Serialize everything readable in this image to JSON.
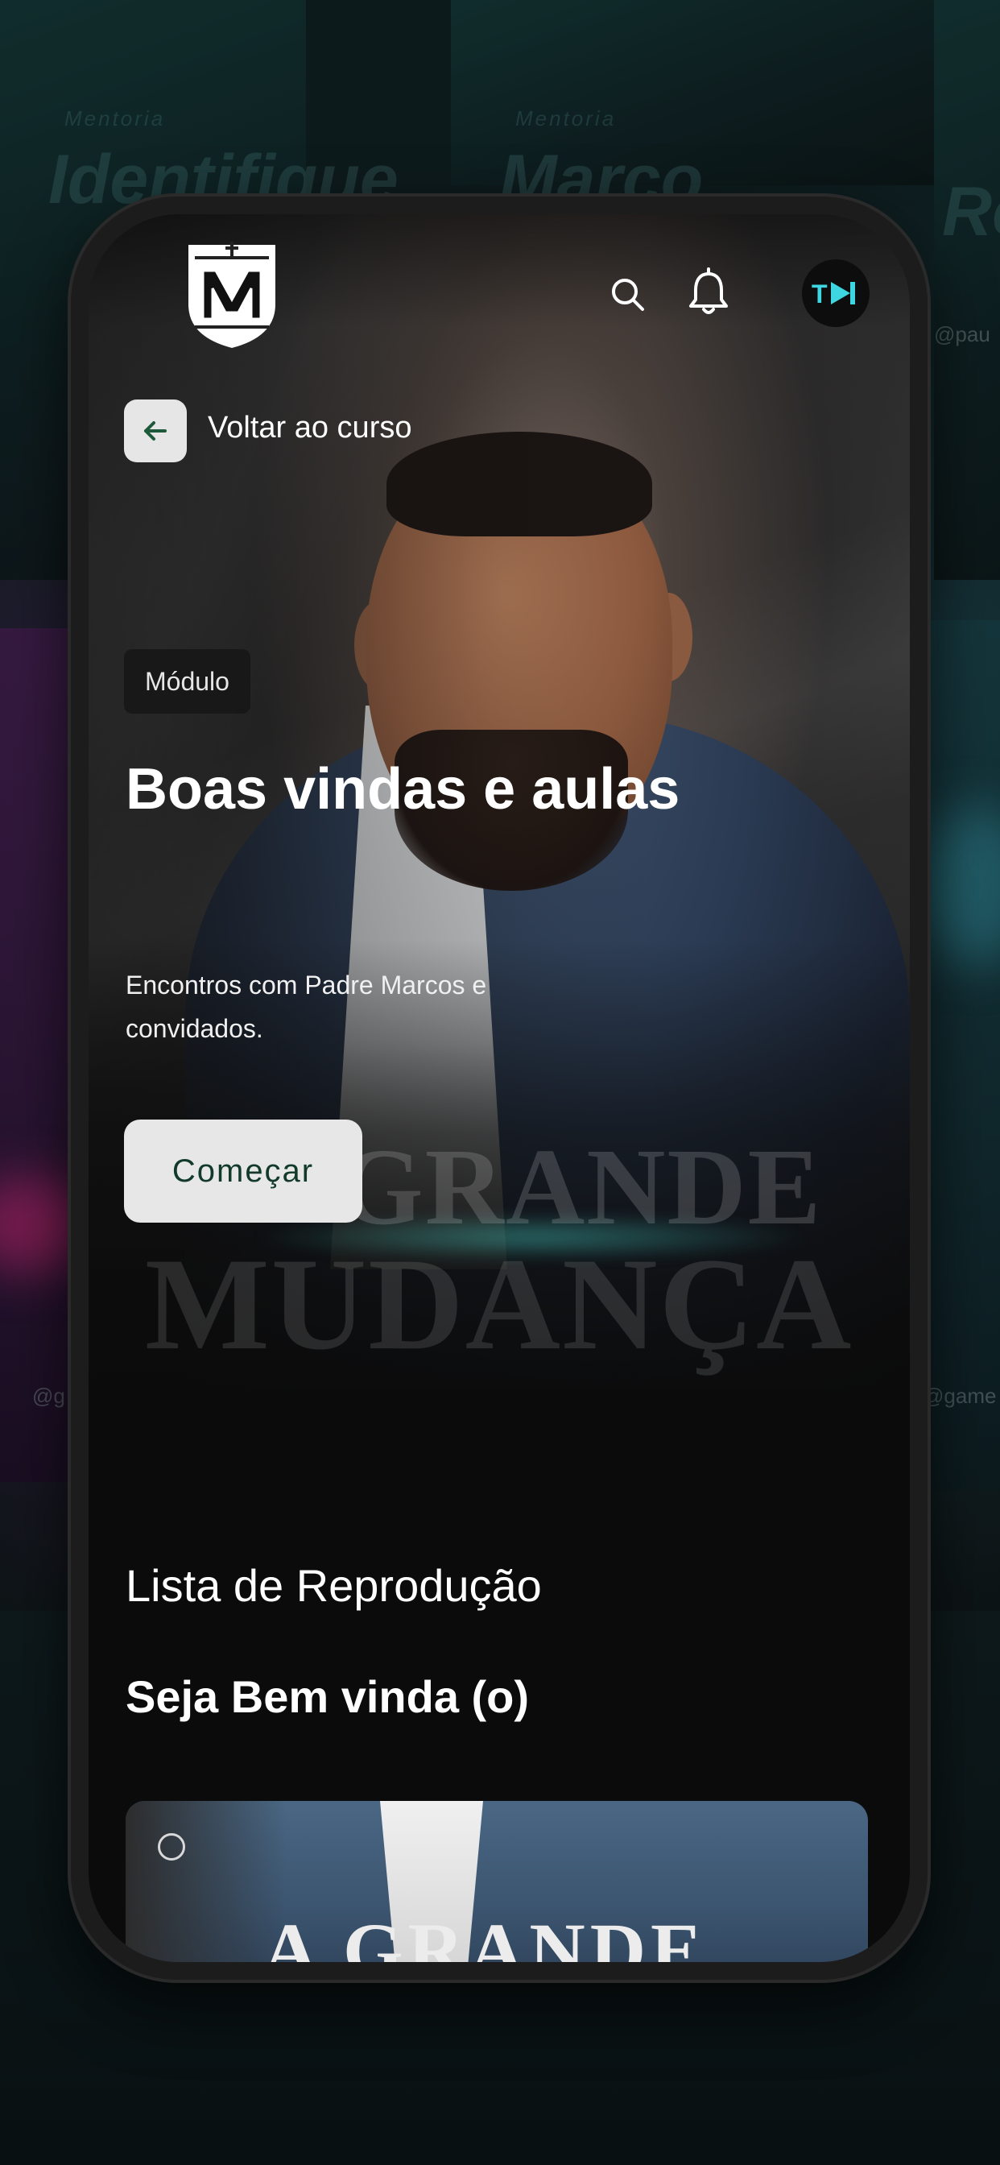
{
  "header": {
    "logo_name": "shield-logo",
    "avatar_text": "T"
  },
  "nav": {
    "back_label": "Voltar ao curso"
  },
  "hero": {
    "chip": "Módulo",
    "title": "Boas vindas e aulas",
    "subtitle": "Encontros com Padre Marcos e convidados.",
    "start_label": "Começar",
    "watermark_line1": "GRANDE",
    "watermark_line2": "MUDANÇA"
  },
  "playlist": {
    "section_title": "Lista de Reprodução",
    "video_title": "Seja Bem vinda (o)",
    "card_text": "A GRANDE"
  },
  "background": {
    "label_left": "Mentoria",
    "label_mid": "Mentoria",
    "title_left": "Identifique",
    "title_mid": "Marco",
    "title_right": "Re",
    "handle_left": "@g",
    "handle_right": "@game",
    "handle_top": "@pau"
  },
  "colors": {
    "accent_green": "#123a2a",
    "button_bg": "#e7e7e7",
    "screen_bg": "#0b0b0b"
  }
}
